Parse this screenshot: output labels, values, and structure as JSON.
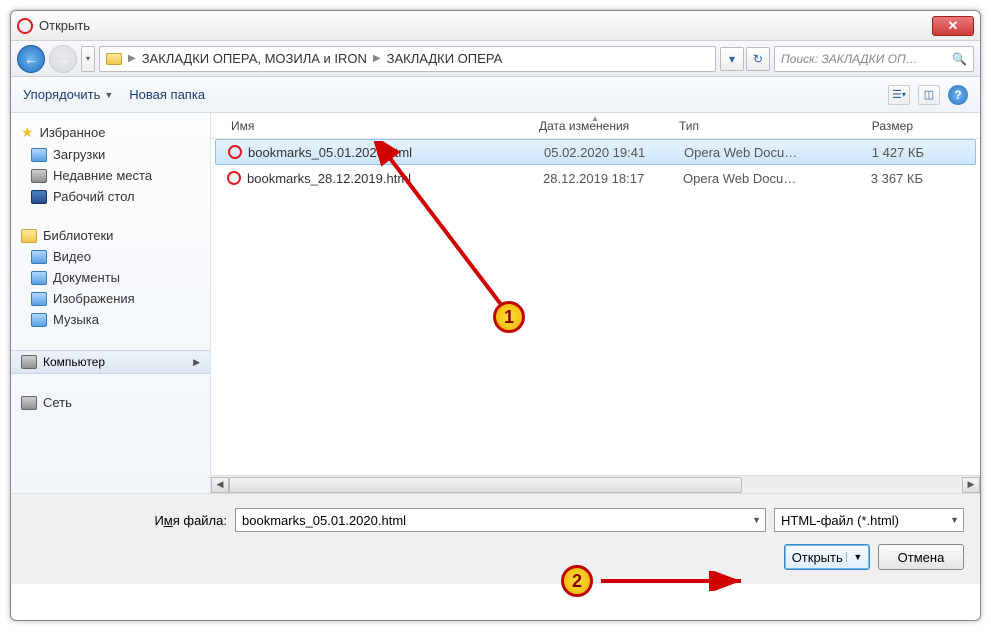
{
  "title": "Открыть",
  "breadcrumb": {
    "seg1": "ЗАКЛАДКИ ОПЕРА,  МОЗИЛА и IRON",
    "seg2": "ЗАКЛАДКИ ОПЕРА"
  },
  "search_placeholder": "Поиск: ЗАКЛАДКИ ОП…",
  "toolbar": {
    "organize": "Упорядочить",
    "newfolder": "Новая папка"
  },
  "sidebar": {
    "favorites": "Избранное",
    "downloads": "Загрузки",
    "recent": "Недавние места",
    "desktop": "Рабочий стол",
    "libraries": "Библиотеки",
    "videos": "Видео",
    "documents": "Документы",
    "pictures": "Изображения",
    "music": "Музыка",
    "computer": "Компьютер",
    "network": "Сеть"
  },
  "columns": {
    "name": "Имя",
    "date": "Дата изменения",
    "type": "Тип",
    "size": "Размер"
  },
  "files": [
    {
      "name": "bookmarks_05.01.2020.html",
      "date": "05.02.2020 19:41",
      "type": "Opera Web Docu…",
      "size": "1 427 КБ",
      "selected": true
    },
    {
      "name": "bookmarks_28.12.2019.html",
      "date": "28.12.2019 18:17",
      "type": "Opera Web Docu…",
      "size": "3 367 КБ",
      "selected": false
    }
  ],
  "filename_label_pre": "И",
  "filename_label_ul": "м",
  "filename_label_post": "я файла:",
  "filename_value": "bookmarks_05.01.2020.html",
  "filetype_value": "HTML-файл (*.html)",
  "buttons": {
    "open": "Открыть",
    "cancel": "Отмена"
  },
  "callouts": {
    "c1": "1",
    "c2": "2"
  }
}
